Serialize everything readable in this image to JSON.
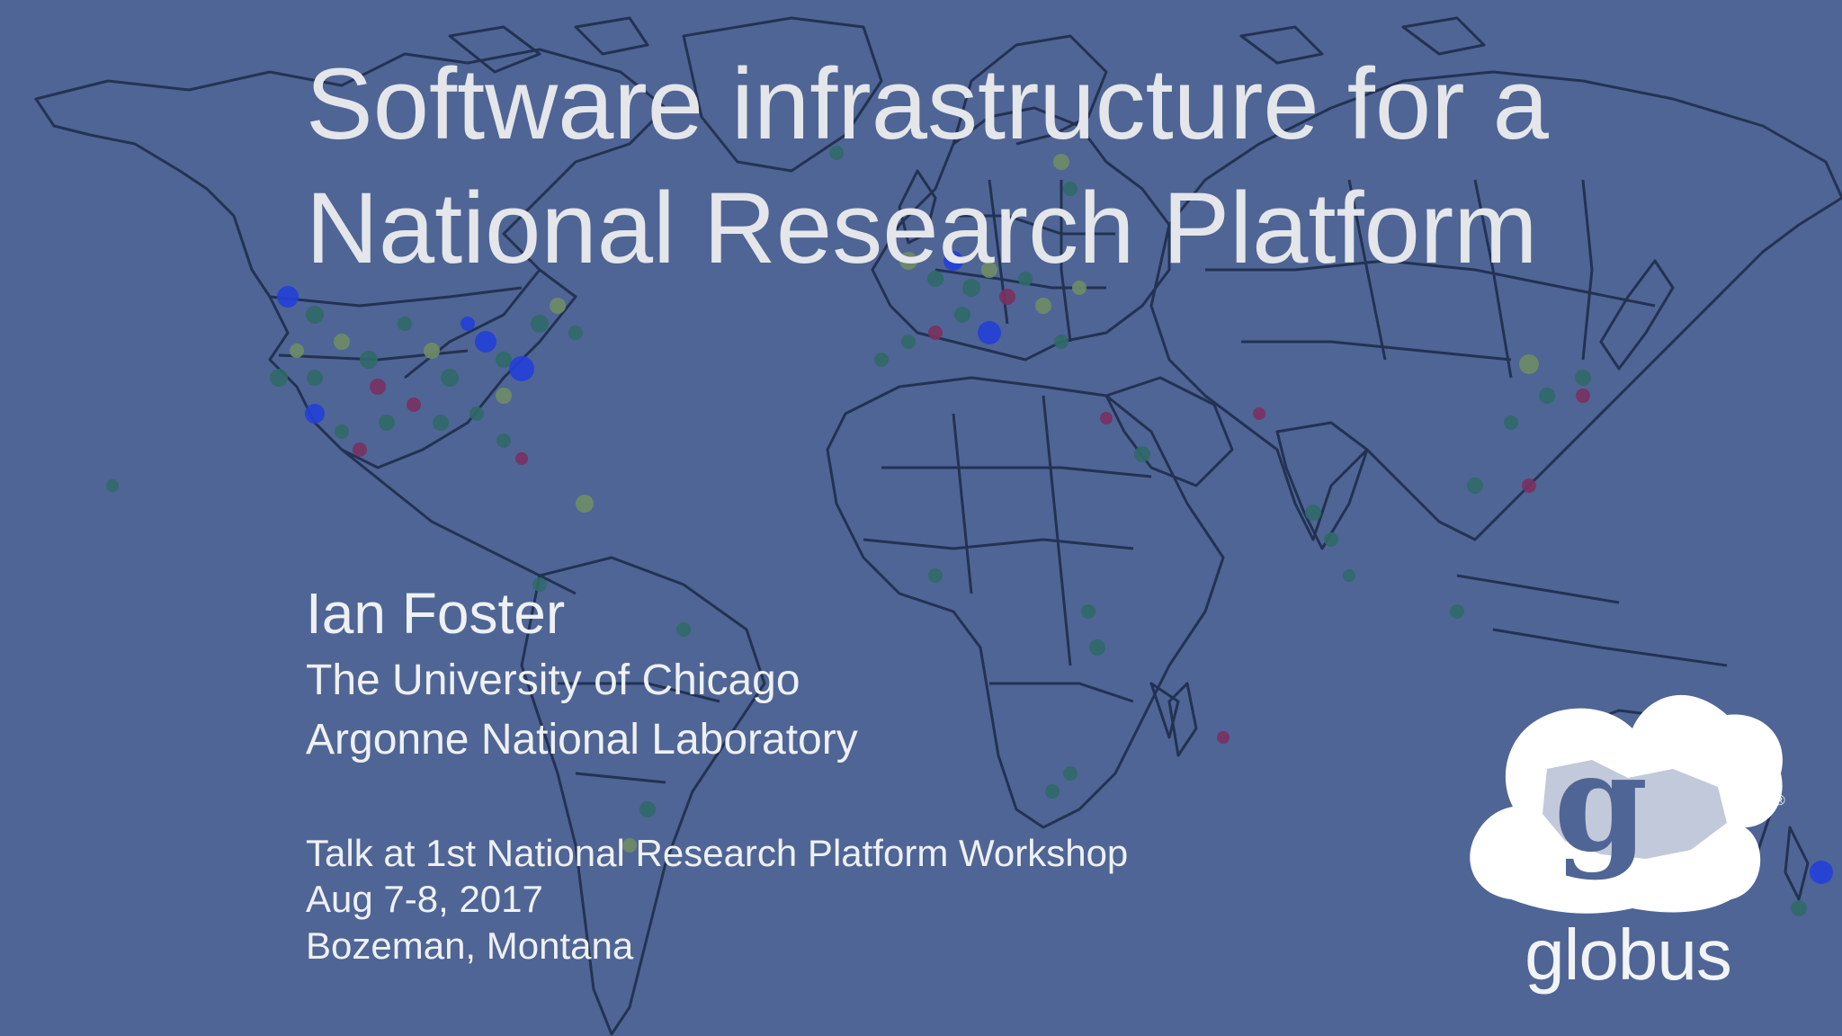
{
  "slide": {
    "title_lines": [
      "Software infrastructure for a",
      "National Research Platform"
    ],
    "speaker": "Ian Foster",
    "affiliations": [
      "The University of Chicago",
      "Argonne National Laboratory"
    ],
    "talk_info": [
      "Talk at 1st National Research Platform Workshop",
      "Aug 7-8, 2017",
      "Bozeman, Montana"
    ],
    "logo": {
      "wordmark": "globus",
      "letter": "g",
      "registered": "®"
    },
    "colors": {
      "background": "#4f6595",
      "map_lines": "#1b2a48",
      "text": "#e4e6ea",
      "marker_green": "#2f6a68",
      "marker_blue": "#2340d8",
      "marker_olive": "#6f8d66",
      "marker_red": "#7a3060"
    },
    "icon": "world-map-background"
  }
}
